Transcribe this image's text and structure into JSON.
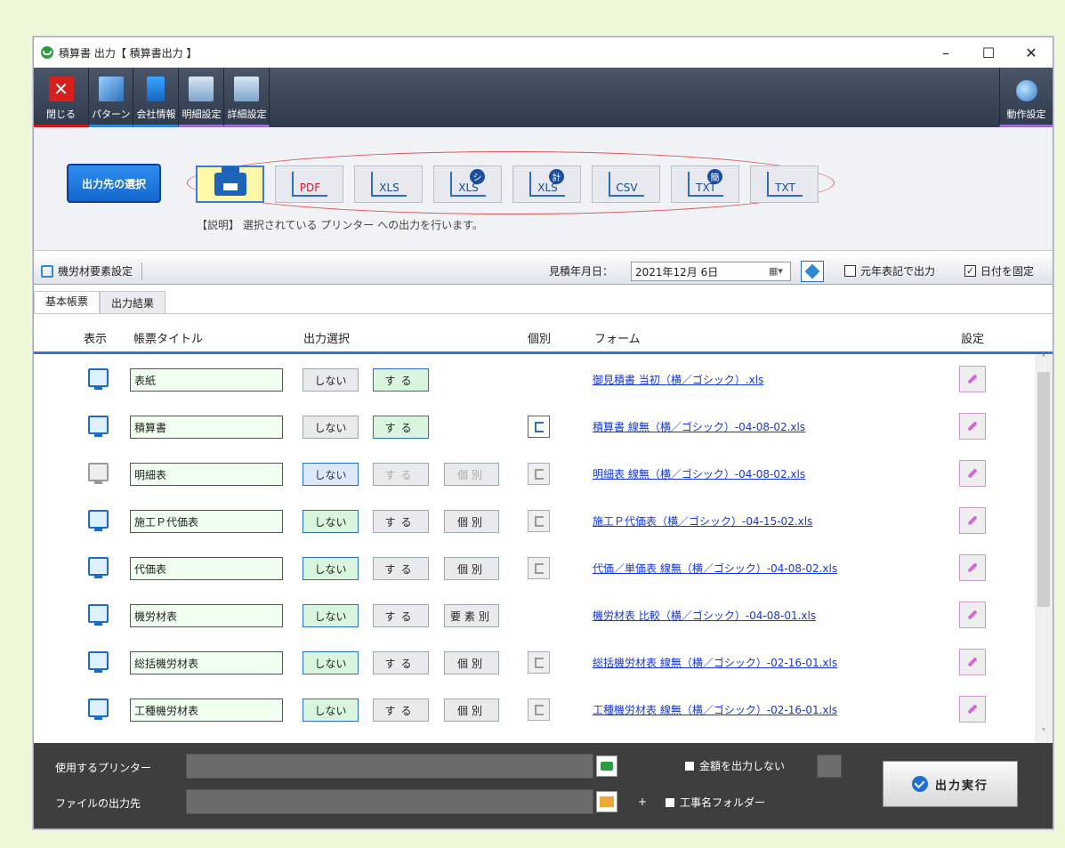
{
  "window": {
    "title": "積算書 出力【 積算書出力 】",
    "controls": {
      "minimize": "–",
      "maximize": "☐",
      "close": "✕"
    }
  },
  "ribbon": {
    "close": "閉じる",
    "pattern": "パターン",
    "company": "会社情報",
    "detail_settings": "明細設定",
    "advanced_settings": "詳細設定",
    "behavior_settings": "動作設定"
  },
  "dest": {
    "select_button": "出力先の選択",
    "formats": [
      {
        "label": "",
        "kind": "printer",
        "selected": true
      },
      {
        "label": "PDF",
        "kind": "pdf"
      },
      {
        "label": "XLS",
        "kind": "xls"
      },
      {
        "label": "XLS",
        "kind": "xls",
        "badge": "シ"
      },
      {
        "label": "XLS",
        "kind": "xls",
        "badge": "計"
      },
      {
        "label": "CSV",
        "kind": "csv"
      },
      {
        "label": "TXT",
        "kind": "txt",
        "badge": "簡"
      },
      {
        "label": "TXT",
        "kind": "txt"
      }
    ],
    "description": "【説明】 選択されている プリンター への出力を行います。"
  },
  "settings_bar": {
    "element_settings": "機労材要素設定",
    "estimate_date_label": "見積年月日：",
    "estimate_date": "2021年12月  6日",
    "calendar_glyph": "▦▾",
    "gengo_label": "元年表記で出力",
    "gengo_checked": false,
    "fix_date_label": "日付を固定",
    "fix_date_checked": true
  },
  "tabs": [
    "基本帳票",
    "出力結果"
  ],
  "grid": {
    "headers": {
      "display": "表示",
      "title": "帳票タイトル",
      "output": "出力選択",
      "individual": "個別",
      "form": "フォーム",
      "settings": "設定"
    },
    "labels": {
      "no": "しない",
      "yes": "する"
    },
    "rows": [
      {
        "title": "表紙",
        "active": true,
        "no_style": "plain",
        "yes_style": "green",
        "ind": "",
        "tree": "none",
        "form": "御見積書 当初（横／ゴシック）.xls"
      },
      {
        "title": "積算書",
        "active": true,
        "no_style": "plain",
        "yes_style": "green",
        "ind": "",
        "tree": "on",
        "form": "積算書 線無（横／ゴシック）-04-08-02.xls"
      },
      {
        "title": "明細表",
        "active": false,
        "no_style": "blueish",
        "yes_style": "dim",
        "ind": "個別",
        "ind_dim": true,
        "tree": "off",
        "form": "明細表 線無（横／ゴシック）-04-08-02.xls"
      },
      {
        "title": "施工Ｐ代価表",
        "active": true,
        "no_style": "green",
        "yes_style": "plain",
        "ind": "個別",
        "tree": "off",
        "form": "施工Ｐ代価表（横／ゴシック）-04-15-02.xls"
      },
      {
        "title": "代価表",
        "active": true,
        "no_style": "green",
        "yes_style": "plain",
        "ind": "個別",
        "tree": "off",
        "form": "代価／単価表 線無（横／ゴシック）-04-08-02.xls"
      },
      {
        "title": "機労材表",
        "active": true,
        "no_style": "green",
        "yes_style": "plain",
        "ind": "要素別",
        "tree": "none",
        "form": "機労材表 比較（横／ゴシック）-04-08-01.xls"
      },
      {
        "title": "総括機労材表",
        "active": true,
        "no_style": "green",
        "yes_style": "plain",
        "ind": "個別",
        "tree": "off",
        "form": "総括機労材表 線無（横／ゴシック）-02-16-01.xls"
      },
      {
        "title": "工種機労材表",
        "active": true,
        "no_style": "green",
        "yes_style": "plain",
        "ind": "個別",
        "tree": "off",
        "form": "工種機労材表 線無（横／ゴシック）-02-16-01.xls"
      }
    ]
  },
  "bottom": {
    "printer_label": "使用するプリンター",
    "output_dir_label": "ファイルの出力先",
    "no_amount_label": "金額を出力しない",
    "plus": "+",
    "job_folder_label": "工事名フォルダー",
    "run_label": "出力実行"
  }
}
